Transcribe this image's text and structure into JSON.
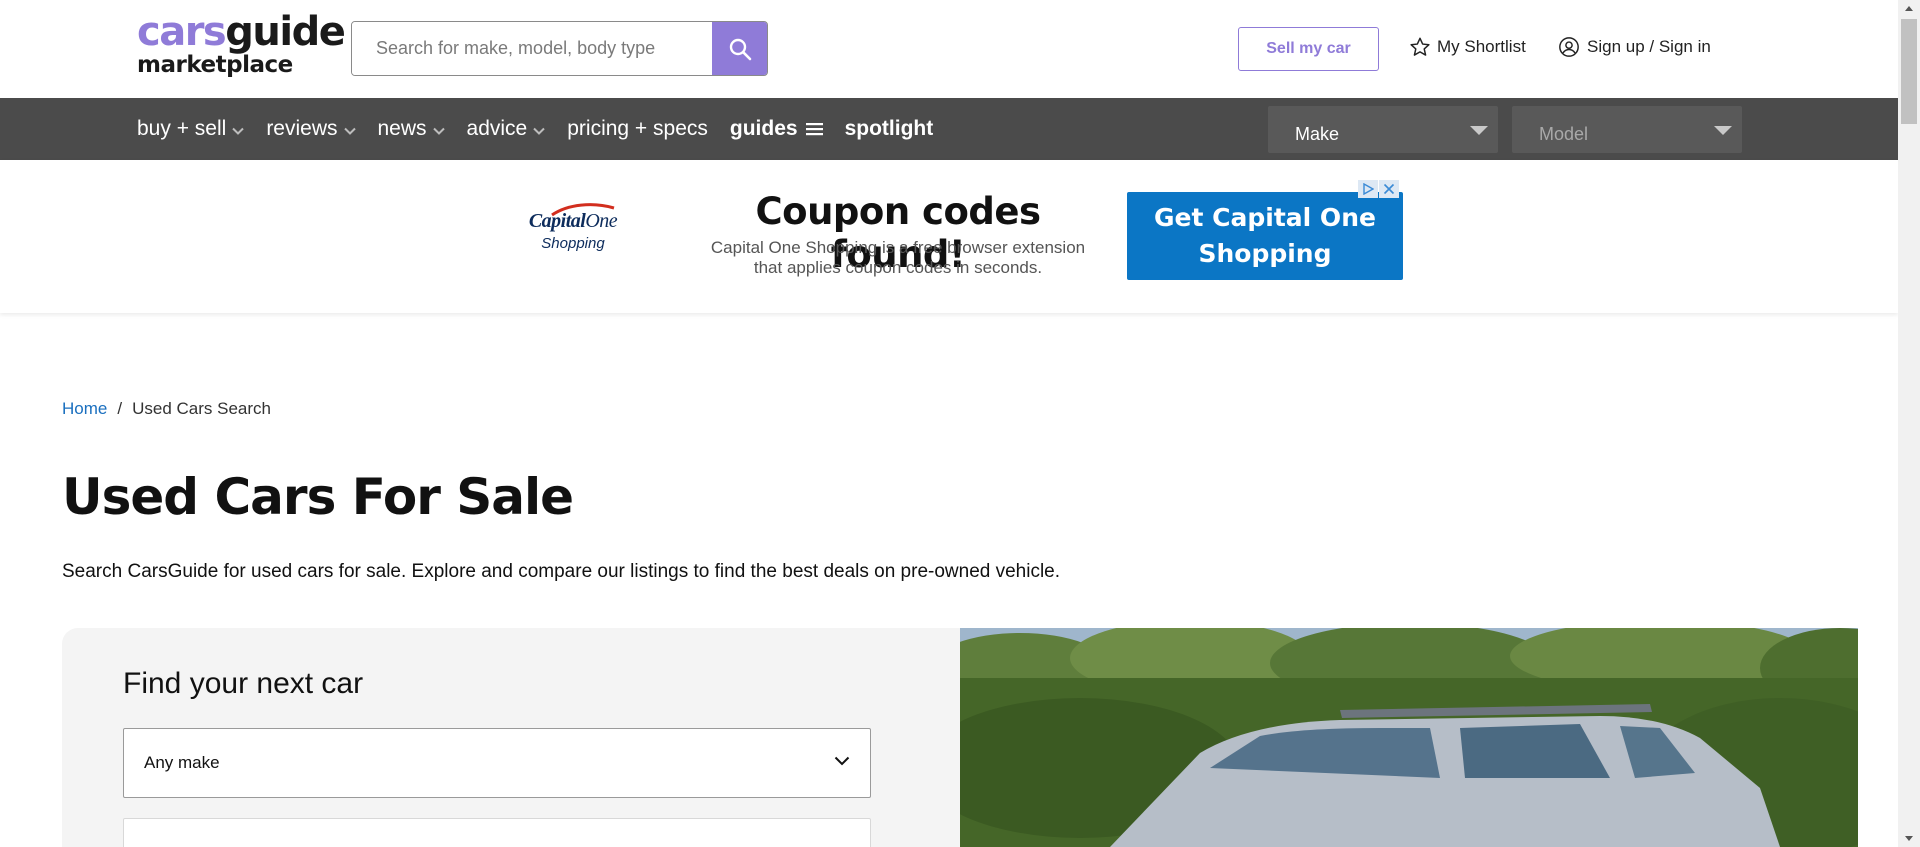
{
  "header": {
    "logo": {
      "cars": "cars",
      "guide": "guide",
      "marketplace": "marketplace"
    },
    "search": {
      "placeholder": "Search for make, model, body type",
      "value": ""
    },
    "sell_label": "Sell my car",
    "shortlist_label": "My Shortlist",
    "signin_label": "Sign up / Sign in"
  },
  "nav": {
    "items": [
      {
        "label": "buy + sell",
        "icon": "chevron-down-icon"
      },
      {
        "label": "reviews",
        "icon": "chevron-down-icon"
      },
      {
        "label": "news",
        "icon": "chevron-down-icon"
      },
      {
        "label": "advice",
        "icon": "chevron-down-icon"
      },
      {
        "label": "pricing + specs"
      },
      {
        "label": "guides",
        "icon": "menu-icon"
      },
      {
        "label": "spotlight"
      }
    ],
    "make_select": "Make",
    "model_select": "Model"
  },
  "ad": {
    "brand": "Capital",
    "brand_suffix": "One",
    "brand_sub": "Shopping",
    "headline": "Coupon codes found!",
    "body": "Capital One Shopping is a free browser extension that applies coupon codes in seconds.",
    "cta": "Get Capital One Shopping"
  },
  "breadcrumb": {
    "home": "Home",
    "separator": "/",
    "current": "Used Cars Search"
  },
  "main": {
    "title": "Used Cars For Sale",
    "description": "Search CarsGuide for used cars for sale. Explore and compare our listings to find the best deals on pre-owned vehicle."
  },
  "finder": {
    "title": "Find your next car",
    "make_value": "Any make"
  },
  "colors": {
    "accent": "#8f7bd8",
    "nav_bg": "#4b4b4b",
    "link": "#1a6fbf",
    "ad_cta": "#0b76c5"
  }
}
